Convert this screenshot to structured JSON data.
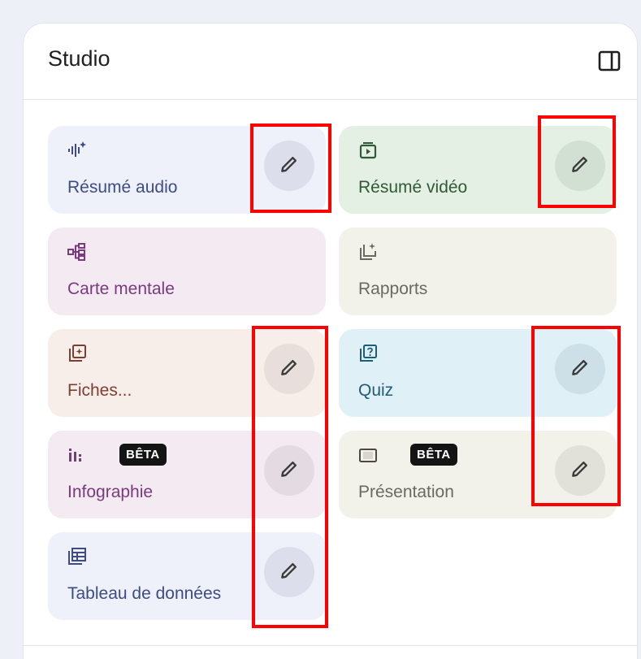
{
  "panel": {
    "title": "Studio",
    "toggle_icon": "side-panel-icon"
  },
  "cards": [
    {
      "id": "resume-audio",
      "label": "Résumé audio",
      "icon": "audio-waveform-icon",
      "color": "#3d4c86",
      "editable": true
    },
    {
      "id": "resume-video",
      "label": "Résumé vidéo",
      "icon": "video-icon",
      "color": "#2f5a37",
      "editable": true
    },
    {
      "id": "carte-mentale",
      "label": "Carte mentale",
      "icon": "mind-map-icon",
      "color": "#7b3a7f",
      "editable": false
    },
    {
      "id": "rapports",
      "label": "Rapports",
      "icon": "report-icon",
      "color": "#6a6a5e",
      "editable": false
    },
    {
      "id": "fiches",
      "label": "Fiches...",
      "icon": "flashcards-icon",
      "color": "#7e3f32",
      "editable": true
    },
    {
      "id": "quiz",
      "label": "Quiz",
      "icon": "quiz-icon",
      "color": "#1f5c78",
      "editable": true
    },
    {
      "id": "infographie",
      "label": "Infographie",
      "badge": "BÊTA",
      "icon": "infographic-icon",
      "color": "#7b3a7f",
      "editable": true
    },
    {
      "id": "presentation",
      "label": "Présentation",
      "badge": "BÊTA",
      "icon": "slides-icon",
      "color": "#6a6a5e",
      "editable": true
    },
    {
      "id": "tableau",
      "label": "Tableau de données",
      "icon": "data-table-icon",
      "color": "#3d4c86",
      "editable": true
    }
  ],
  "edit_icon": "pencil-icon",
  "highlight_color": "#ff0000"
}
